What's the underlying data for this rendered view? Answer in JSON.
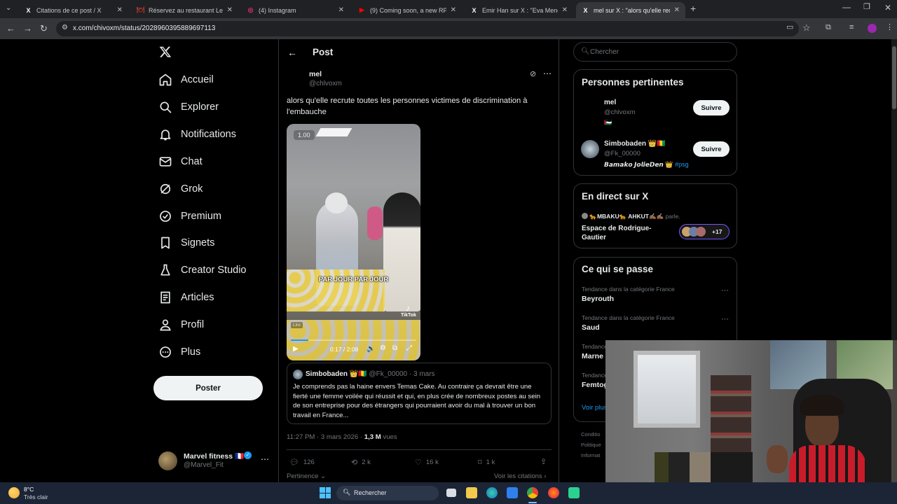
{
  "browser": {
    "tabs": [
      {
        "title": "Citations de ce post / X",
        "fav": "X"
      },
      {
        "title": "Réservez au restaurant Le Jules...",
        "fav": "🍽"
      },
      {
        "title": "(4) Instagram",
        "fav": "◎"
      },
      {
        "title": "(9) Coming soon, a new RPG fr...",
        "fav": "▶"
      },
      {
        "title": "Emir Han sur X : \"Eva Mendes s...",
        "fav": "X"
      },
      {
        "title": "mel sur X : \"alors qu'elle recrute...",
        "fav": "X"
      }
    ],
    "url": "x.com/chivoxm/status/2028960395889697113"
  },
  "nav": {
    "items": [
      {
        "label": "Accueil",
        "icon": "home-icon"
      },
      {
        "label": "Explorer",
        "icon": "search-icon"
      },
      {
        "label": "Notifications",
        "icon": "bell-icon"
      },
      {
        "label": "Chat",
        "icon": "mail-icon"
      },
      {
        "label": "Grok",
        "icon": "grok-icon"
      },
      {
        "label": "Premium",
        "icon": "premium-icon"
      },
      {
        "label": "Signets",
        "icon": "bookmark-icon"
      },
      {
        "label": "Creator Studio",
        "icon": "flask-icon"
      },
      {
        "label": "Articles",
        "icon": "article-icon"
      },
      {
        "label": "Profil",
        "icon": "person-icon"
      },
      {
        "label": "Plus",
        "icon": "more-circle-icon"
      }
    ],
    "post_button": "Poster",
    "account": {
      "name": "Marvel fitness 🇫🇷",
      "handle": "@Marvel_Fit"
    }
  },
  "post": {
    "header_title": "Post",
    "author_name": "mel",
    "author_handle": "@chlvoxm",
    "text": "alors qu'elle recrute toutes les personnes victimes de discrimination à l'embauche",
    "video": {
      "speed": "1.00",
      "caption": "PAR JOUR PAR JOUR",
      "watermark": "TikTok",
      "watermark_handle": "@...",
      "time": "0:17 / 2:08",
      "live_badge": "Lire",
      "progress": 0.14
    },
    "quote": {
      "author": "Simbobaden 👑🇬🇳",
      "handle": "@Fk_00000",
      "date": "· 3 mars",
      "text": "Je comprends pas la haine envers Temas Cake. Au contraire ça devrait être une fierté une femme voilée qui réussit et qui, en plus crée de nombreux postes au sein de son entreprise pour des étrangers qui pourraient avoir du mal à trouver un bon travail en France..."
    },
    "timestamp": "11:27 PM · 3 mars 2026 · ",
    "views_count": "1,3 M",
    "views_label": " vues",
    "stats": {
      "replies": "126",
      "reposts": "2 k",
      "likes": "16 k",
      "bookmarks": "1 k"
    },
    "sort_label": "Pertinence",
    "quotes_link": "Voir les citations"
  },
  "sidebar": {
    "search_placeholder": "Chercher",
    "relevant": {
      "title": "Personnes pertinentes",
      "people": [
        {
          "name": "mel",
          "handle": "@chlvoxm",
          "bio": "🇵🇸",
          "button": "Suivre"
        },
        {
          "name": "Simbobaden 👑🇬🇳",
          "handle": "@Fk_00000",
          "bio": "𝘽𝙖𝙢𝙖𝙠𝙤 𝙅𝙤𝙡𝙞𝙚𝘿𝙚𝙣 👑",
          "bio_tag": "#psg",
          "button": "Suivre"
        }
      ]
    },
    "live": {
      "title": "En direct sur X",
      "speakers": "🐆MBAKU🐆 AHKUT✍🏾✍🏾",
      "speakers_suffix": " parle.",
      "space_title": "Espace de Rodrigue-Gautier",
      "listeners": "+17"
    },
    "trends": {
      "title": "Ce qui se passe",
      "items": [
        {
          "meta": "Tendance dans la catégorie France",
          "name": "Beyrouth"
        },
        {
          "meta": "Tendance dans la catégorie France",
          "name": "Saud"
        },
        {
          "meta": "Tendance",
          "name": "Marne"
        },
        {
          "meta": "Tendance",
          "name": "Femtog"
        }
      ],
      "more_link": "Voir plus"
    },
    "footer": [
      "Conditio",
      "Politique",
      "Informat"
    ]
  },
  "taskbar": {
    "weather_temp": "8°C",
    "weather_desc": "Très clair",
    "search_label": "Rechercher"
  },
  "colors": {
    "accent": "#1d9bf0",
    "bg": "#000000",
    "border": "#2f3336",
    "muted": "#71767b"
  }
}
